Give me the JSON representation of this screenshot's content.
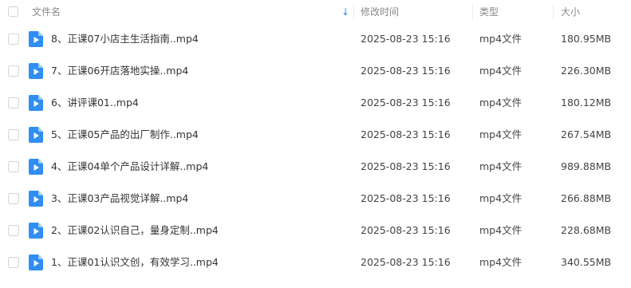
{
  "header": {
    "name_label": "文件名",
    "modified_label": "修改时间",
    "type_label": "类型",
    "size_label": "大小",
    "sort_arrow": "↓"
  },
  "files": [
    {
      "name": "8、正课07小店主生活指南..mp4",
      "modified": "2025-08-23 15:16",
      "type": "mp4文件",
      "size": "180.95MB"
    },
    {
      "name": "7、正课06开店落地实操..mp4",
      "modified": "2025-08-23 15:16",
      "type": "mp4文件",
      "size": "226.30MB"
    },
    {
      "name": "6、讲评课01..mp4",
      "modified": "2025-08-23 15:16",
      "type": "mp4文件",
      "size": "180.12MB"
    },
    {
      "name": "5、正课05产品的出厂制作..mp4",
      "modified": "2025-08-23 15:16",
      "type": "mp4文件",
      "size": "267.54MB"
    },
    {
      "name": "4、正课04单个产品设计详解..mp4",
      "modified": "2025-08-23 15:16",
      "type": "mp4文件",
      "size": "989.88MB"
    },
    {
      "name": "3、正课03产品视觉详解..mp4",
      "modified": "2025-08-23 15:16",
      "type": "mp4文件",
      "size": "266.88MB"
    },
    {
      "name": "2、正课02认识自己，量身定制..mp4",
      "modified": "2025-08-23 15:16",
      "type": "mp4文件",
      "size": "228.68MB"
    },
    {
      "name": "1、正课01认识文创，有效学习..mp4",
      "modified": "2025-08-23 15:16",
      "type": "mp4文件",
      "size": "340.55MB"
    }
  ],
  "colors": {
    "icon_blue": "#2f8ef3",
    "header_text": "#888888",
    "row_text": "#333333"
  },
  "icons": {
    "file": "video-file-icon"
  }
}
